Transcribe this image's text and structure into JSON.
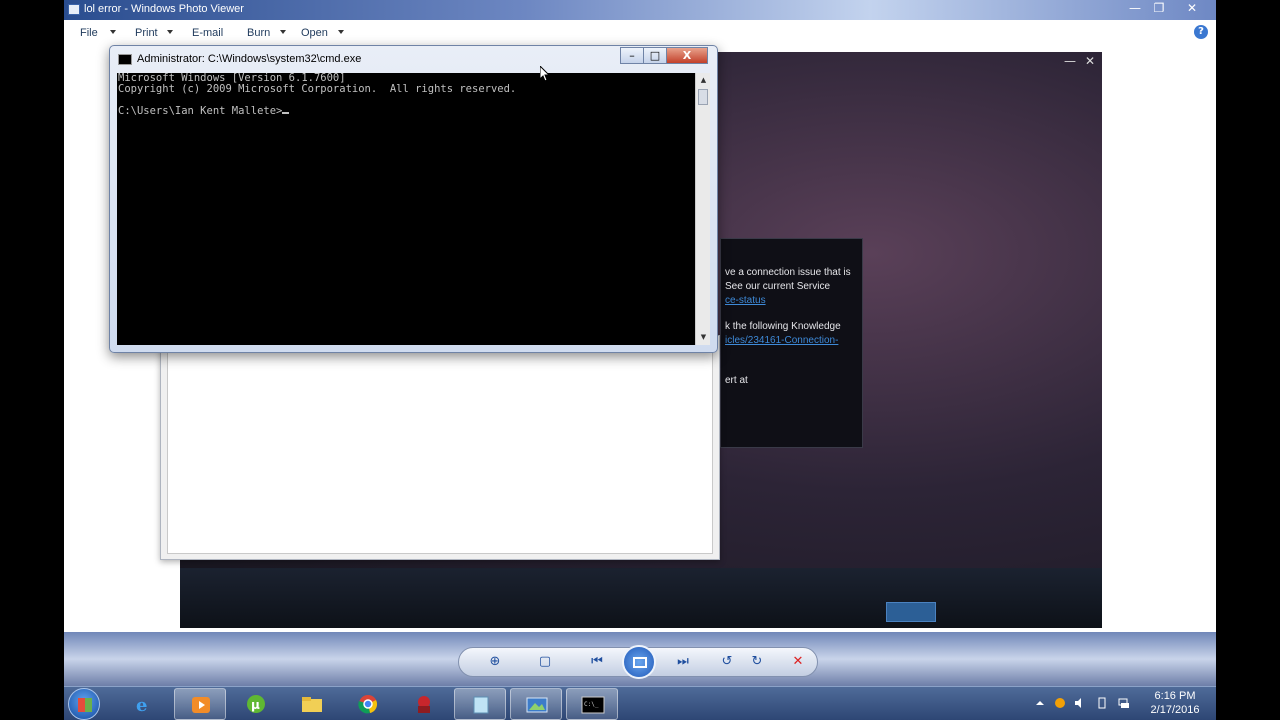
{
  "photo_viewer": {
    "title": "lol error - Windows Photo Viewer",
    "window_controls": {
      "minimize": "—",
      "maximize": "❐",
      "close": "✕"
    },
    "menu": [
      {
        "label": "File"
      },
      {
        "label": "Print"
      },
      {
        "label": "E-mail"
      },
      {
        "label": "Burn"
      },
      {
        "label": "Open"
      }
    ],
    "help_icon": "?"
  },
  "game_client": {
    "window_controls": {
      "minimize": "—",
      "close": "✕"
    },
    "dialog_lines": [
      "ve a connection issue that is",
      "See our current Service",
      "ce-status",
      "k the following Knowledge",
      "icles/234161-Connection-",
      "ert at"
    ]
  },
  "cmd": {
    "title": "Administrator: C:\\Windows\\system32\\cmd.exe",
    "buttons": {
      "minimize": "–",
      "maximize": "□",
      "close": "X"
    },
    "lines": [
      "Microsoft Windows [Version 6.1.7600]",
      "Copyright (c) 2009 Microsoft Corporation.  All rights reserved.",
      "",
      "C:\\Users\\Ian Kent Mallete>"
    ]
  },
  "viewer_toolbar": {
    "zoom": "⊕",
    "fit": "▢",
    "previous": "⏮",
    "next": "⏭",
    "rotate_ccw": "↺",
    "rotate_cw": "↻",
    "delete": "✕"
  },
  "taskbar": {
    "items": [
      "start",
      "internet-explorer",
      "media-player",
      "utorrent",
      "folder",
      "chrome",
      "game-app",
      "notepad",
      "photo-viewer",
      "cmd"
    ],
    "clock_time": "6:16 PM",
    "clock_date": "2/17/2016"
  }
}
